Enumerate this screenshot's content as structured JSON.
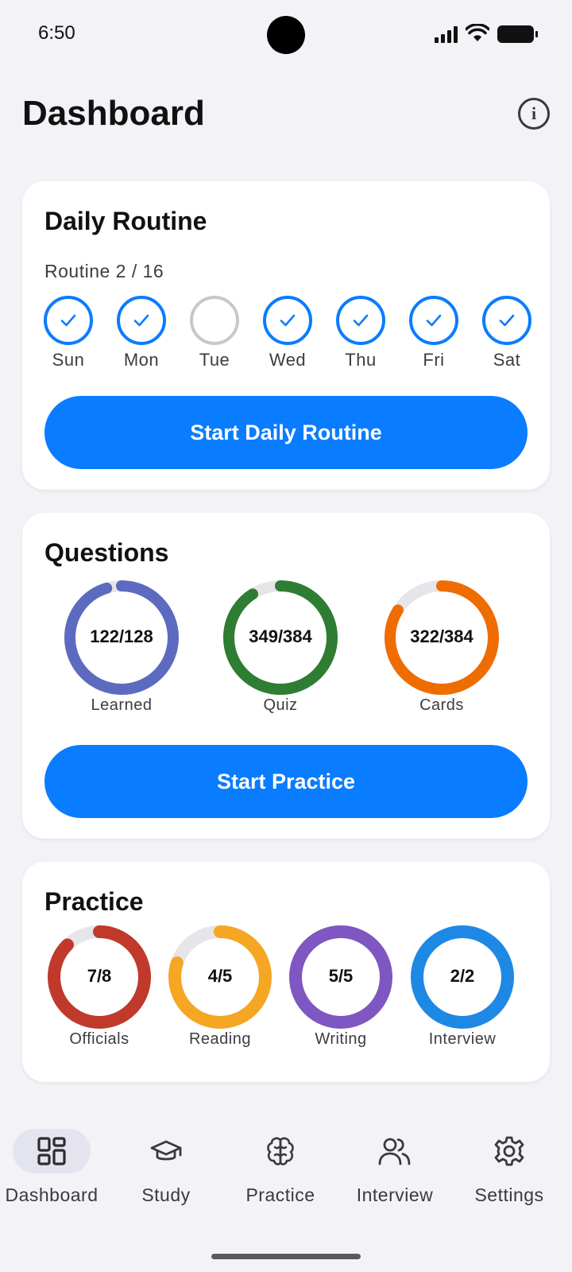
{
  "status_bar": {
    "time": "6:50"
  },
  "header": {
    "title": "Dashboard",
    "info_icon": "info-icon"
  },
  "routine_card": {
    "title": "Daily Routine",
    "progress_text": "Routine 2 / 16",
    "days": [
      {
        "label": "Sun",
        "done": true
      },
      {
        "label": "Mon",
        "done": true
      },
      {
        "label": "Tue",
        "done": false
      },
      {
        "label": "Wed",
        "done": true
      },
      {
        "label": "Thu",
        "done": true
      },
      {
        "label": "Fri",
        "done": true
      },
      {
        "label": "Sat",
        "done": true
      }
    ],
    "button_label": "Start Daily Routine"
  },
  "questions_card": {
    "title": "Questions",
    "rings": [
      {
        "value": "122/128",
        "label": "Learned",
        "fraction": 0.953,
        "color": "#5c6bc0"
      },
      {
        "value": "349/384",
        "label": "Quiz",
        "fraction": 0.909,
        "color": "#2e7d32"
      },
      {
        "value": "322/384",
        "label": "Cards",
        "fraction": 0.839,
        "color": "#ef6c00"
      }
    ],
    "button_label": "Start Practice"
  },
  "practice_card": {
    "title": "Practice",
    "rings": [
      {
        "value": "7/8",
        "label": "Officials",
        "fraction": 0.875,
        "color": "#c0392b"
      },
      {
        "value": "4/5",
        "label": "Reading",
        "fraction": 0.8,
        "color": "#f5a623"
      },
      {
        "value": "5/5",
        "label": "Writing",
        "fraction": 1.0,
        "color": "#7e57c2"
      },
      {
        "value": "2/2",
        "label": "Interview",
        "fraction": 1.0,
        "color": "#1e88e5"
      }
    ]
  },
  "colors": {
    "accent": "#0a7cff",
    "ring_track": "#e5e5ea",
    "inactive_day": "#c7c7cc"
  },
  "bottom_nav": {
    "items": [
      {
        "label": "Dashboard",
        "icon": "dashboard-grid-icon",
        "active": true
      },
      {
        "label": "Study",
        "icon": "graduation-cap-icon",
        "active": false
      },
      {
        "label": "Practice",
        "icon": "brain-icon",
        "active": false
      },
      {
        "label": "Interview",
        "icon": "users-icon",
        "active": false
      },
      {
        "label": "Settings",
        "icon": "gear-icon",
        "active": false
      }
    ]
  }
}
